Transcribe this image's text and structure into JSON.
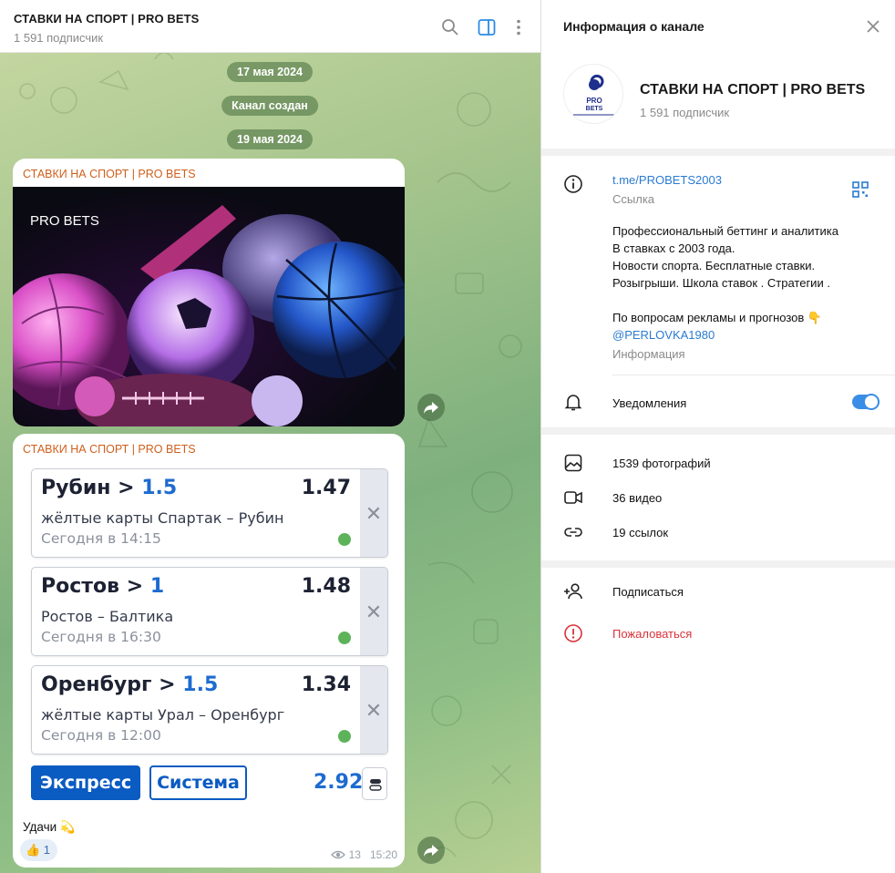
{
  "chat": {
    "title": "СТАВКИ НА СПОРТ | PRO BETS",
    "subscribers": "1 591 подписчик",
    "service_messages": [
      "17 мая 2024",
      "Канал создан",
      "19 мая 2024"
    ],
    "message1": {
      "sender": "СТАВКИ НА СПОРТ | PRO BETS",
      "photo_caption": "PRO BETS"
    },
    "message2": {
      "sender": "СТАВКИ НА СПОРТ | PRO BETS",
      "bets": [
        {
          "team": "Рубин > ",
          "value": "1.5",
          "odds": "1.47",
          "event": "жёлтые карты Спартак – Рубин",
          "time": "Сегодня в 14:15"
        },
        {
          "team": "Ростов > ",
          "value": "1",
          "odds": "1.48",
          "event": "Ростов – Балтика",
          "time": "Сегодня в 16:30"
        },
        {
          "team": "Оренбург > ",
          "value": "1.5",
          "odds": "1.34",
          "event": "жёлтые карты Урал – Оренбург",
          "time": "Сегодня в 12:00"
        }
      ],
      "express_label": "Экспресс",
      "system_label": "Система",
      "total_odds": "2.92",
      "text": "Удачи 💫",
      "reaction": "👍 1",
      "views": "13",
      "time": "15:20"
    }
  },
  "info": {
    "title": "Информация о канале",
    "channel_name": "СТАВКИ НА СПОРТ | PRO BETS",
    "subscribers": "1 591 подписчик",
    "avatar_text": "PRO BETS",
    "link": "t.me/PROBETS2003",
    "link_label": "Ссылка",
    "description": "Профессиональный беттинг и аналитика\nВ ставках с 2003 года.\nНовости спорта. Бесплатные ставки.\nРозыгрыши. Школа ставок . Стратегии .\n\nПо вопросам рекламы и прогнозов 👇",
    "contact": "@PERLOVKA1980",
    "description_label": "Информация",
    "notifications_label": "Уведомления",
    "notifications_on": true,
    "media": [
      {
        "icon": "photo-icon",
        "label": "1539 фотографий"
      },
      {
        "icon": "video-icon",
        "label": "36 видео"
      },
      {
        "icon": "link-icon",
        "label": "19 ссылок"
      }
    ],
    "subscribe_label": "Подписаться",
    "report_label": "Пожаловаться",
    "colors": {
      "accent": "#2a7bd1",
      "danger": "#d9323a",
      "sender": "#d05f1c",
      "toggle": "#3a8ee6"
    }
  }
}
